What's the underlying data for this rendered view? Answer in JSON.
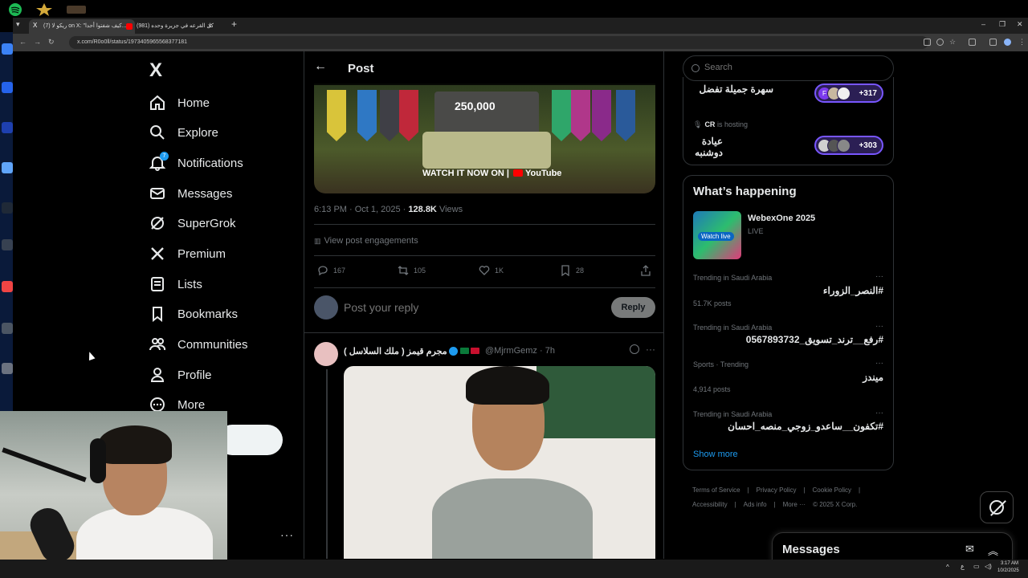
{
  "browser": {
    "tabs": [
      {
        "title": "(7) ريكو لا on X: \"كيف شفتوا أحدا...",
        "active": true
      },
      {
        "title": "(981) كل القرعه في جزيرة وحده",
        "active": false
      }
    ],
    "url": "x.com/R0o0ll/status/1973405965568377181",
    "new_tab": "+",
    "close": "×"
  },
  "nav": {
    "logo": "X",
    "items": [
      {
        "label": "Home",
        "icon": "home-icon"
      },
      {
        "label": "Explore",
        "icon": "search-icon"
      },
      {
        "label": "Notifications",
        "icon": "bell-icon",
        "badge": "7"
      },
      {
        "label": "Messages",
        "icon": "envelope-icon"
      },
      {
        "label": "SuperGrok",
        "icon": "grok-icon"
      },
      {
        "label": "Premium",
        "icon": "x-icon"
      },
      {
        "label": "Lists",
        "icon": "list-icon"
      },
      {
        "label": "Bookmarks",
        "icon": "bookmark-icon"
      },
      {
        "label": "Communities",
        "icon": "people-icon"
      },
      {
        "label": "Profile",
        "icon": "person-icon"
      },
      {
        "label": "More",
        "icon": "more-circle-icon"
      }
    ],
    "account_more": "···"
  },
  "post": {
    "header_title": "Post",
    "media": {
      "price": "250,000",
      "cta": "WATCH IT NOW ON |",
      "platform": "YouTube"
    },
    "time": "6:13 PM · Oct 1, 2025 ·",
    "views_count": "128.8K",
    "views_label": "Views",
    "engagements": "View post engagements",
    "actions": {
      "replies": "167",
      "reposts": "105",
      "likes": "1K",
      "bookmarks": "28"
    },
    "reply_placeholder": "Post your reply",
    "reply_button": "Reply"
  },
  "reply_tweet": {
    "name": "مجرم قيمز ( ملك السلاسل )",
    "handle": "@MjrmGemz · 7h",
    "more": "···"
  },
  "right": {
    "search_placeholder": "Search",
    "spaces": [
      {
        "title": "سهرة جميلة تفضل",
        "count": "+317",
        "host_prefix": "",
        "host": "",
        "host_suffix": ""
      },
      {
        "title": "عيادة دوشنبه",
        "count": "+303",
        "host_prefix": "",
        "host": "CR",
        "host_suffix": "is hosting"
      }
    ],
    "whats_happening": "What’s happening",
    "event": {
      "title": "WebexOne 2025",
      "status": "LIVE",
      "thumb_text": "Watch live"
    },
    "trends": [
      {
        "category": "Trending in Saudi Arabia",
        "name": "#النصر_الزوراء",
        "count": "51.7K posts"
      },
      {
        "category": "Trending in Saudi Arabia",
        "name": "#رفع__ترند_تسويق_0567893732",
        "count": ""
      },
      {
        "category": "Sports · Trending",
        "name": "ميندز",
        "count": "4,914 posts"
      },
      {
        "category": "Trending in Saudi Arabia",
        "name": "#تكفون__ساعدو_زوجي_منصه_احسان",
        "count": ""
      }
    ],
    "show_more": "Show more",
    "footer": [
      "Terms of Service",
      "|",
      "Privacy Policy",
      "|",
      "Cookie Policy",
      "|",
      "Accessibility",
      "|",
      "Ads info",
      "|",
      "More ···",
      "© 2025 X Corp."
    ]
  },
  "messages_drawer": {
    "title": "Messages"
  },
  "taskbar": {
    "time": "3:17 AM",
    "date": "10/2/2025",
    "lang": "ع"
  },
  "colors": {
    "accent": "#1d9bf0",
    "spaces": "#7856ff",
    "bg": "#000000",
    "text": "#e7e9ea",
    "muted": "#71767b"
  }
}
